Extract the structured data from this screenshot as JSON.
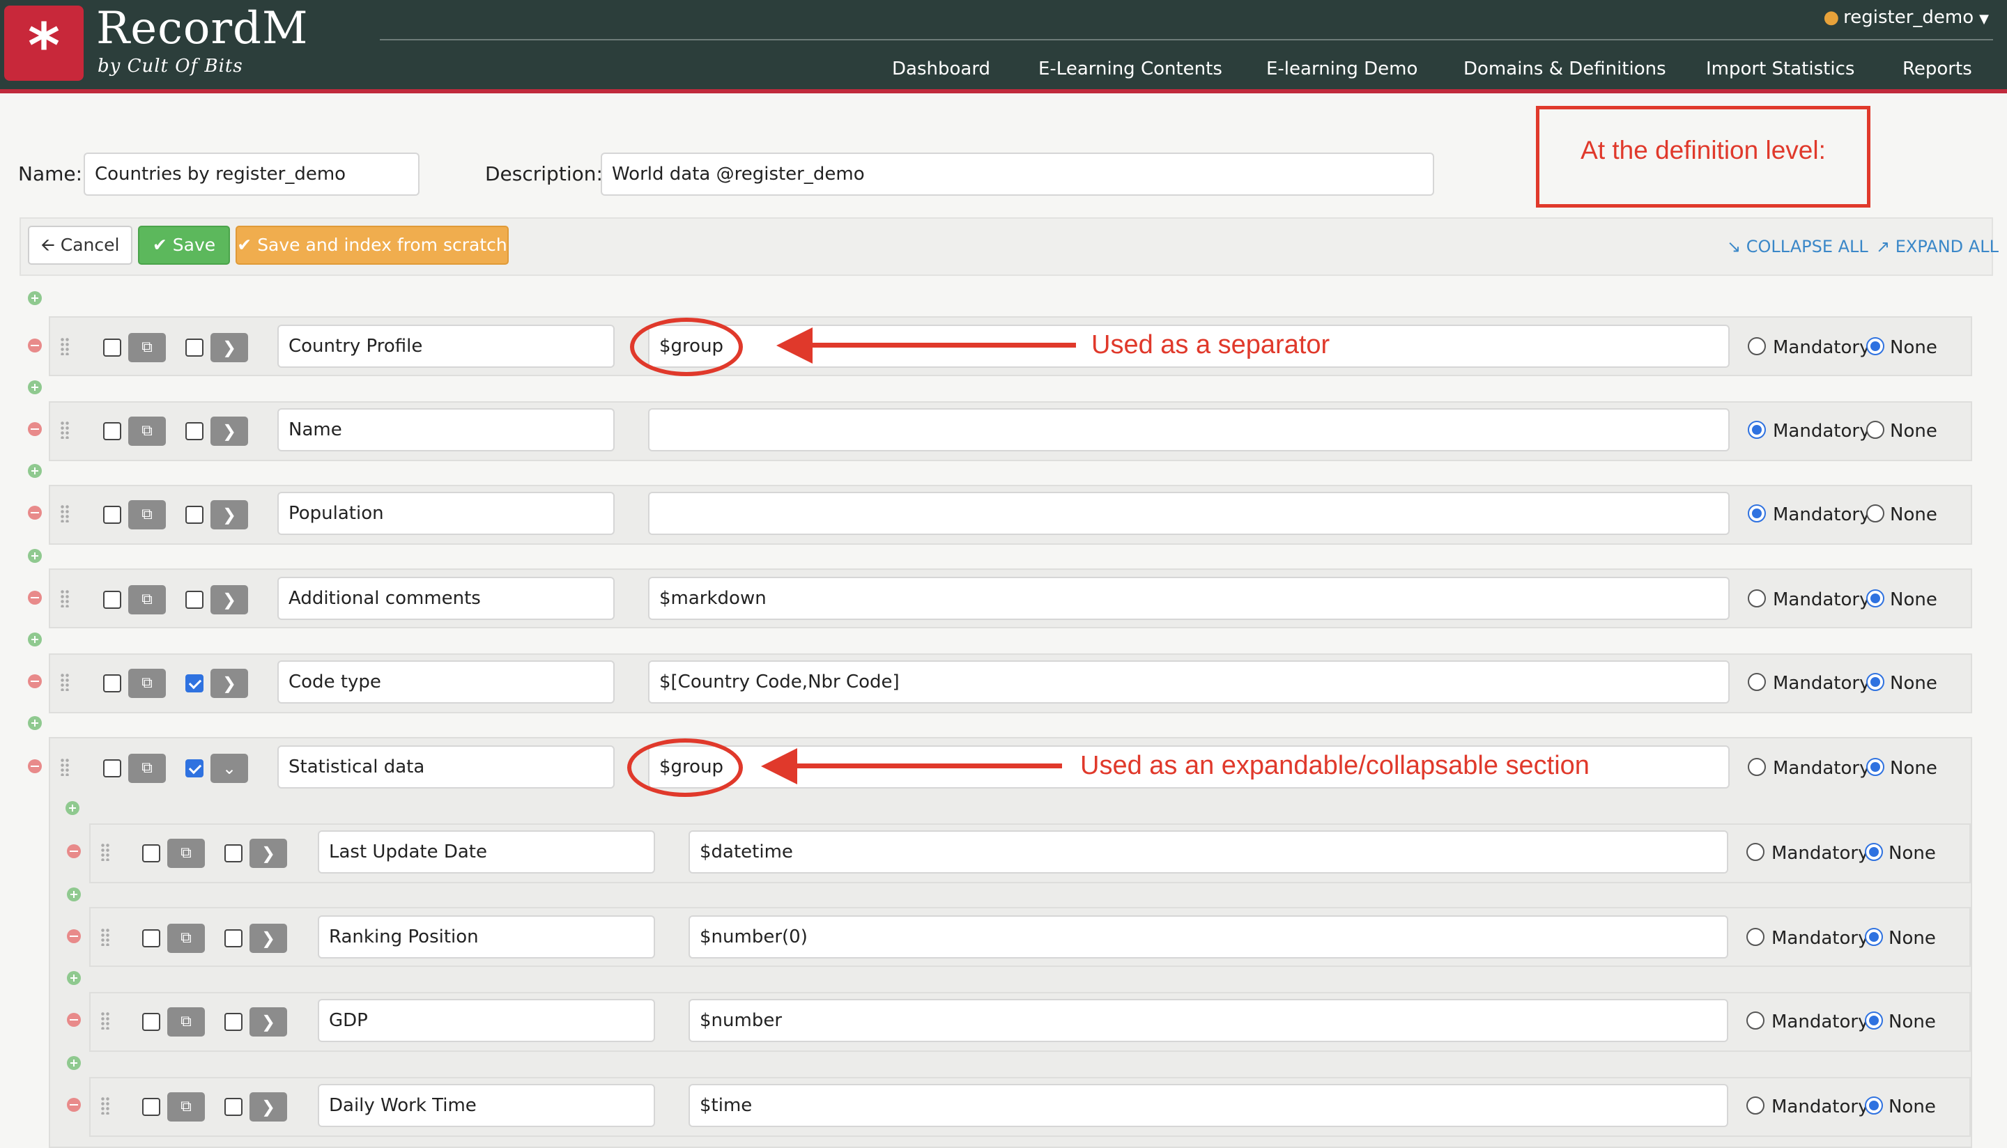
{
  "app": {
    "brand": "RecordM",
    "subtitle": "by Cult Of Bits",
    "user": "register_demo"
  },
  "nav": [
    "Dashboard",
    "E-Learning Contents",
    "E-learning Demo",
    "Domains & Definitions",
    "Import Statistics",
    "Reports"
  ],
  "form": {
    "name_label": "Name:",
    "name_value": "Countries by register_demo",
    "description_label": "Description:",
    "description_value": "World data @register_demo"
  },
  "toolbar": {
    "cancel": "Cancel",
    "save": "Save",
    "save_index": "Save and index from scratch",
    "collapse_all": "COLLAPSE ALL",
    "expand_all": "EXPAND ALL"
  },
  "annotations": {
    "definition_level": "At the definition level:",
    "separator": "Used as a separator",
    "section": "Used as an expandable/collapsable section"
  },
  "radio_labels": {
    "mandatory": "Mandatory",
    "none": "None"
  },
  "fields": [
    {
      "name": "Country Profile",
      "description": "$group",
      "mandatory": false,
      "checked": false,
      "expanded": false
    },
    {
      "name": "Name",
      "description": "",
      "mandatory": true,
      "checked": false,
      "expanded": false
    },
    {
      "name": "Population",
      "description": "",
      "mandatory": true,
      "checked": false,
      "expanded": false
    },
    {
      "name": "Additional comments",
      "description": "$markdown",
      "mandatory": false,
      "checked": false,
      "expanded": false
    },
    {
      "name": "Code type",
      "description": "$[Country Code,Nbr Code]",
      "mandatory": false,
      "checked": true,
      "expanded": false
    },
    {
      "name": "Statistical data",
      "description": "$group",
      "mandatory": false,
      "checked": true,
      "expanded": true
    },
    {
      "name": "Last Update Date",
      "description": "$datetime",
      "mandatory": false,
      "checked": false,
      "expanded": false
    },
    {
      "name": "Ranking Position",
      "description": "$number(0)",
      "mandatory": false,
      "checked": false,
      "expanded": false
    },
    {
      "name": "GDP",
      "description": "$number",
      "mandatory": false,
      "checked": false,
      "expanded": false
    },
    {
      "name": "Daily Work Time",
      "description": "$time",
      "mandatory": false,
      "checked": false,
      "expanded": false
    }
  ],
  "icons": {
    "logo": "asterisk-icon",
    "user": "person-icon",
    "cancel": "arrow-left-icon",
    "save": "check-icon",
    "copy": "copy-icon",
    "expand": "chevron-right-icon",
    "collapse": "chevron-down-icon",
    "drag": "drag-handle-icon",
    "add": "plus-circle-icon",
    "remove": "minus-circle-icon"
  },
  "colors": {
    "header": "#2c3e3b",
    "brand": "#c8283a",
    "annotation": "#e0392b",
    "link": "#3a87c8"
  }
}
